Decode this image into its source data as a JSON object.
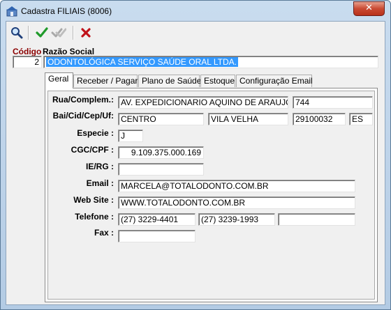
{
  "window": {
    "title": "Cadastra FILIAIS (8006)",
    "close_glyph": "✕"
  },
  "toolbar": {
    "icons": [
      "search-icon",
      "confirm-check-icon",
      "confirm-all-disabled-icon",
      "cancel-x-icon"
    ]
  },
  "header": {
    "codigo_label": "Código",
    "razao_label": "Razão Social",
    "codigo_value": "2",
    "razao_value": "ODONTOLÓGICA SERVIÇO SAÚDE ORAL LTDA."
  },
  "tabs": [
    {
      "label": "Geral",
      "active": true
    },
    {
      "label": "Receber / Pagar",
      "active": false
    },
    {
      "label": "Plano de Saúde",
      "active": false
    },
    {
      "label": "Estoque",
      "active": false
    },
    {
      "label": "Configuração Email",
      "active": false
    }
  ],
  "form": {
    "rua_label": "Rua/Complem.:",
    "rua_value": "AV. EXPEDICIONARIO AQUINO DE ARAUJO",
    "complemento_value": "744",
    "bai_label": "Bai/Cid/Cep/Uf:",
    "bairro_value": "CENTRO",
    "cidade_value": "VILA VELHA",
    "cep_value": "29100032",
    "uf_value": "ES",
    "especie_label": "Especie :",
    "especie_value": "J",
    "cgc_label": "CGC/CPF :",
    "cgc_value": "9.109.375.000.169",
    "ie_label": "IE/RG :",
    "ie_value": "",
    "email_label": "Email :",
    "email_value": "MARCELA@TOTALODONTO.COM.BR",
    "website_label": "Web Site :",
    "website_value": "WWW.TOTALODONTO.COM.BR",
    "telefone_label": "Telefone :",
    "telefone1_value": "(27) 3229-4401",
    "telefone2_value": "(27) 3239-1993",
    "telefone3_value": "",
    "fax_label": "Fax :",
    "fax_value": ""
  },
  "colors": {
    "codigo_label": "#8b0000",
    "selection": "#3399ff",
    "confirm_green": "#1f9a2a",
    "cancel_red": "#c0121a"
  }
}
